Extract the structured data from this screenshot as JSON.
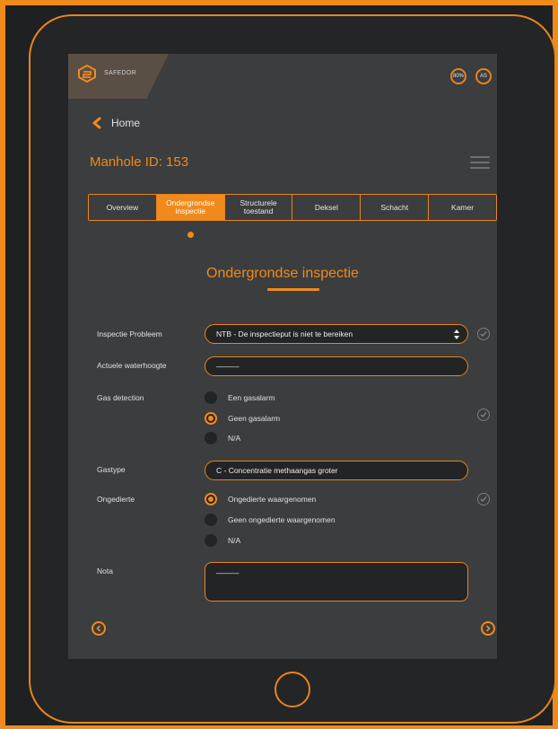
{
  "header": {
    "logo_text": "SAFEDOR",
    "user_badge_1": "80%",
    "user_badge_2": "AS"
  },
  "nav": {
    "back_label": "Home"
  },
  "page": {
    "title": "Manhole ID: 153"
  },
  "tabs": [
    {
      "label": "Overview",
      "active": false
    },
    {
      "label": "Ondergrondse inspectie",
      "active": true
    },
    {
      "label": "Structurele toestand",
      "active": false
    },
    {
      "label": "Deksel",
      "active": false
    },
    {
      "label": "Schacht",
      "active": false
    },
    {
      "label": "Kamer",
      "active": false
    }
  ],
  "section": {
    "title": "Ondergrondse inspectie"
  },
  "form": {
    "inspectie_probleem": {
      "label": "Inspectie Probleem",
      "value": "NTB - De inspectieput is niet te bereiken"
    },
    "actuele_waterhoogte": {
      "label": "Actuele waterhoogte",
      "value": "———"
    },
    "gas_detection": {
      "label": "Gas detection",
      "options": [
        "Een gasalarm",
        "Geen gasalarm",
        "N/A"
      ],
      "selected": "Geen gasalarm"
    },
    "gastype": {
      "label": "Gastype",
      "value": "C - Concentratie methaangas groter"
    },
    "ongedierte": {
      "label": "Ongedierte",
      "options": [
        "Ongedierte waargenomen",
        "Geen ongedierte waargenomen",
        "N/A"
      ],
      "selected": "Ongedierte waargenomen"
    },
    "nota": {
      "label": "Nota",
      "value": "———"
    }
  },
  "colors": {
    "accent": "#f08a1c",
    "screen_bg": "#3b3d3e",
    "field_bg": "#232425"
  },
  "icons": {
    "back": "chevron-left-icon",
    "menu": "hamburger-icon",
    "check": "check-circle-icon",
    "prev": "chevron-left-circle-icon",
    "next": "chevron-right-circle-icon"
  }
}
